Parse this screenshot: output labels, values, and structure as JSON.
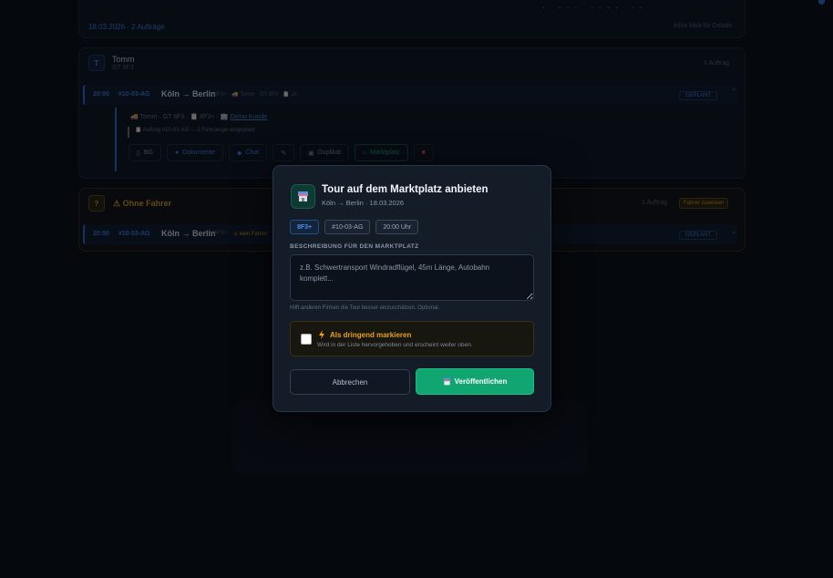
{
  "background": {
    "top_date_group": {
      "label": "18.03.2026 · 2 Aufträge",
      "right": "Infos klick für Details"
    },
    "driver_card": {
      "initial": "T",
      "name": "Tomm",
      "sub": "GT 8F3",
      "count": "1 Auftrag",
      "order": {
        "time": "20:00",
        "number": "#10-03-AG",
        "route": "Köln → Berlin",
        "meta": "8F3+ · 🚚 Tomm · GT 8F3 · 📋 2x",
        "status": "GEPLANT"
      },
      "detail_line1": "🚚 Tomm · GT 8F3 · 📋 8F3+ · 🏢",
      "detail_link": "Demo Kunde",
      "detail_line2": "📋 Auftrag #10-03-AG — 2 Fahrzeuge eingeplant",
      "actions": [
        {
          "label": "BG",
          "icon": "document-icon"
        },
        {
          "label": "Dokumente",
          "icon": "pin-icon"
        },
        {
          "label": "Chat",
          "icon": "chat-icon"
        },
        {
          "label": "",
          "icon": "edit-icon"
        },
        {
          "label": "Duplikat",
          "icon": "copy-icon"
        },
        {
          "label": "Marktplatz",
          "icon": "store-icon"
        },
        {
          "label": "",
          "icon": "trash-icon"
        }
      ]
    },
    "unassigned_card": {
      "initial": "?",
      "title": "⚠ Ohne Fahrer",
      "count": "1 Auftrag",
      "button": "Fahrer zuweisen",
      "order": {
        "time": "20:00",
        "number": "#10-03-AG",
        "route": "Köln → Berlin",
        "meta": "8F3+",
        "no_driver": "⚠ kein Fahrer",
        "status": "GEPLANT"
      }
    }
  },
  "modal": {
    "icon": "market-icon",
    "title": "Tour auf dem Marktplatz anbieten",
    "subtitle": "Köln → Berlin · 18.03.2026",
    "chips": [
      "8F3+",
      "#10-03-AG",
      "20:00 Uhr"
    ],
    "description_label": "BESCHREIBUNG FÜR DEN MARKTPLATZ",
    "description_value": "",
    "description_placeholder": "z.B. Schwertransport Windradflügel, 45m Länge, Autobahn komplett...",
    "hint": "Hilft anderen Firmen die Tour besser einzuschätzen. Optional.",
    "urgent": {
      "checked": false,
      "title": "Als dringend markieren",
      "subtitle": "Wird in der Liste hervorgehoben und erscheint weiter oben."
    },
    "cancel_label": "Abbrechen",
    "publish_label": "Veröffentlichen",
    "colors": {
      "accent": "#10a571",
      "warning": "#e6a01f",
      "blue": "#3c82e8"
    }
  }
}
